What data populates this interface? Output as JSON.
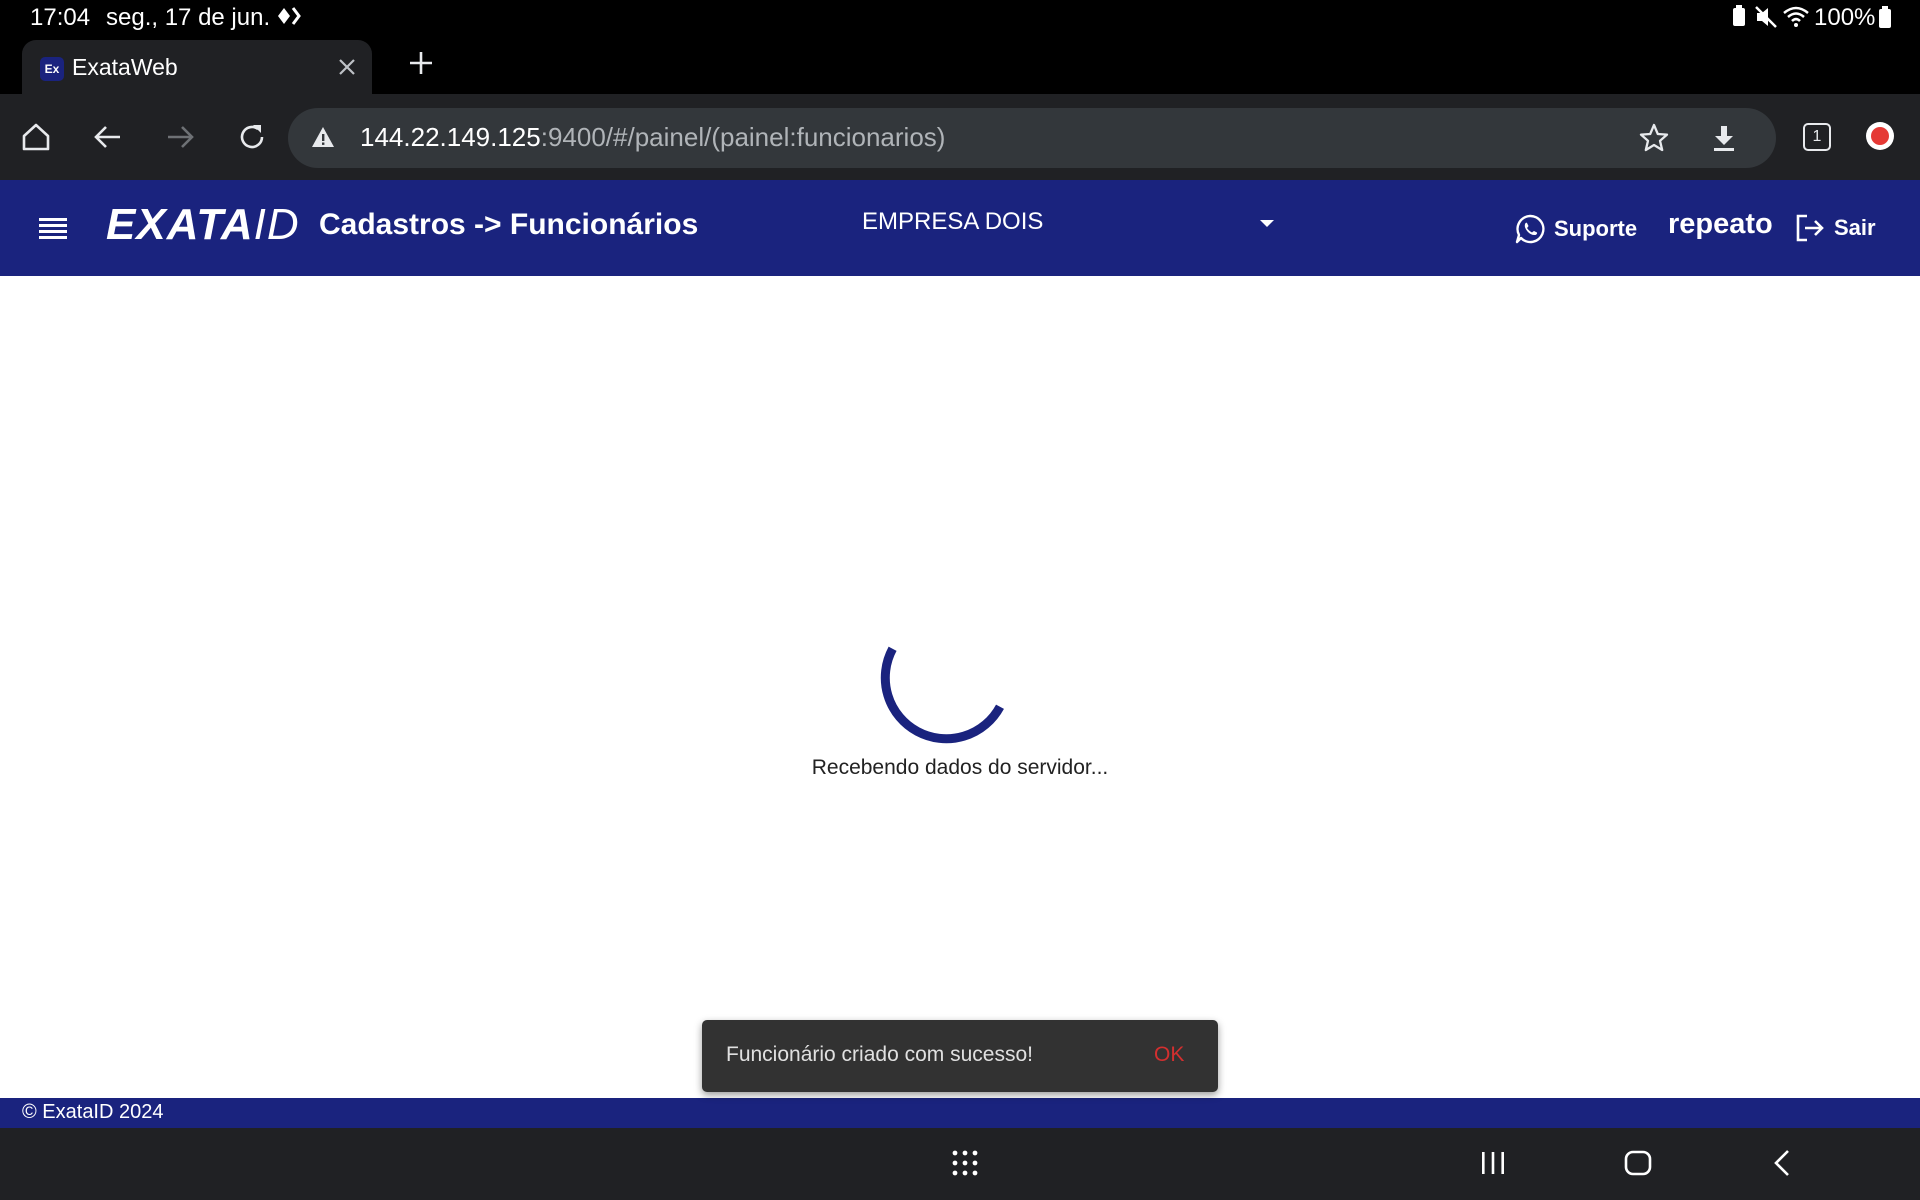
{
  "status_bar": {
    "time": "17:04",
    "date": "seg., 17 de jun.",
    "battery": "100%"
  },
  "browser": {
    "tab": {
      "favicon_text": "Ex",
      "title": "ExataWeb"
    },
    "url": {
      "host": "144.22.149.125",
      "path": ":9400/#/painel/(painel:funcionarios)"
    },
    "tab_count": "1"
  },
  "app": {
    "logo": {
      "word": "EXATA",
      "suffix": "ID"
    },
    "page_title": "Cadastros -> Funcionários",
    "company": "EMPRESA DOIS",
    "support_label": "Suporte",
    "username": "repeato",
    "logout_label": "Sair",
    "accent_color": "#1a237e"
  },
  "main": {
    "loading_text": "Recebendo dados do servidor..."
  },
  "snackbar": {
    "message": "Funcionário criado com sucesso!",
    "action": "OK"
  },
  "footer": {
    "copyright": "© ExataID 2024"
  }
}
